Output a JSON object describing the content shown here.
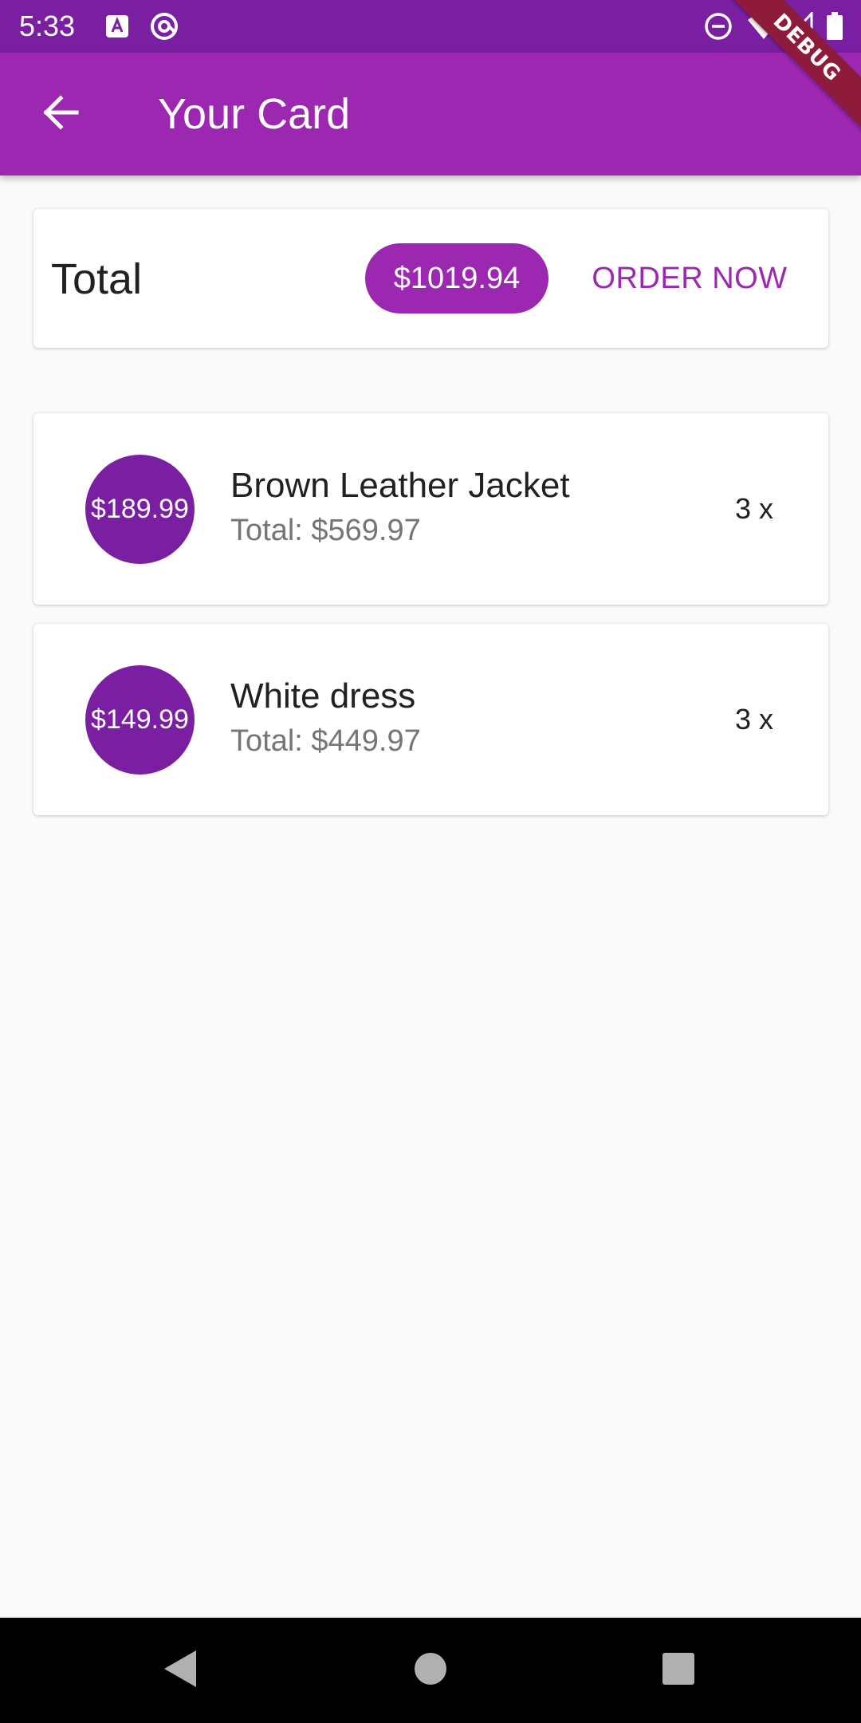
{
  "status_bar": {
    "time": "5:33",
    "left_icons": [
      "a-badge-icon",
      "at-sign-icon"
    ],
    "right_icons": [
      "do-not-disturb-icon",
      "wifi-icon",
      "cell-signal-icon",
      "battery-icon"
    ]
  },
  "debug_banner": "DEBUG",
  "app_bar": {
    "title": "Your Card",
    "back_icon": "arrow-back-icon"
  },
  "summary": {
    "label": "Total",
    "amount": "$1019.94",
    "order_button": "ORDER NOW"
  },
  "cart_items": [
    {
      "price": "$189.99",
      "title": "Brown Leather Jacket",
      "subtotal": "Total: $569.97",
      "quantity": "3 x"
    },
    {
      "price": "$149.99",
      "title": "White dress",
      "subtotal": "Total: $449.97",
      "quantity": "3 x"
    }
  ],
  "nav_bar": [
    "back-triangle-icon",
    "home-circle-icon",
    "recents-square-icon"
  ],
  "colors": {
    "primary": "#9c27b0",
    "primary_dark": "#7b1fa2",
    "background": "#fafafa",
    "debug": "#8e1b3a"
  }
}
